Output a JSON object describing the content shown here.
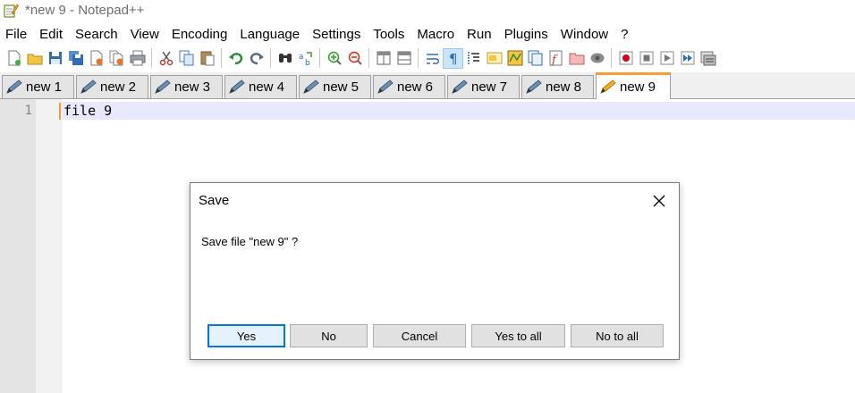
{
  "window": {
    "title": "*new 9 - Notepad++"
  },
  "menu": [
    "File",
    "Edit",
    "Search",
    "View",
    "Encoding",
    "Language",
    "Settings",
    "Tools",
    "Macro",
    "Run",
    "Plugins",
    "Window",
    "?"
  ],
  "toolbar": {
    "icons": [
      "new-file-icon",
      "open-file-icon",
      "save-icon",
      "save-all-icon",
      "close-icon",
      "close-all-icon",
      "print-icon",
      "cut-icon",
      "copy-icon",
      "paste-icon",
      "undo-icon",
      "redo-icon",
      "find-icon",
      "replace-icon",
      "zoom-in-icon",
      "zoom-out-icon",
      "sync-vertical-icon",
      "sync-horizontal-icon",
      "word-wrap-icon",
      "show-all-characters-icon",
      "indent-guide-icon",
      "language-udl-icon",
      "document-map-icon",
      "document-list-icon",
      "function-list-icon",
      "folder-workspace-icon",
      "monitoring-icon",
      "record-macro-icon",
      "stop-recording-icon",
      "play-macro-icon",
      "run-macro-multiple-icon",
      "save-macro-icon"
    ],
    "active": "show-all-characters-icon"
  },
  "tabs": [
    {
      "label": "new 1"
    },
    {
      "label": "new 2"
    },
    {
      "label": "new 3"
    },
    {
      "label": "new 4"
    },
    {
      "label": "new 5"
    },
    {
      "label": "new 6"
    },
    {
      "label": "new 7"
    },
    {
      "label": "new 8"
    },
    {
      "label": "new 9",
      "active": true
    }
  ],
  "editor": {
    "line_number": "1",
    "text": "file 9"
  },
  "dialog": {
    "title": "Save",
    "message": "Save file \"new 9\" ?",
    "buttons": {
      "yes": "Yes",
      "no": "No",
      "cancel": "Cancel",
      "yes_all": "Yes to all",
      "no_all": "No to all"
    }
  },
  "colors": {
    "active_tab_accent": "#f39c38",
    "default_button_border": "#0078d7",
    "current_line": "#e8e8ff"
  }
}
